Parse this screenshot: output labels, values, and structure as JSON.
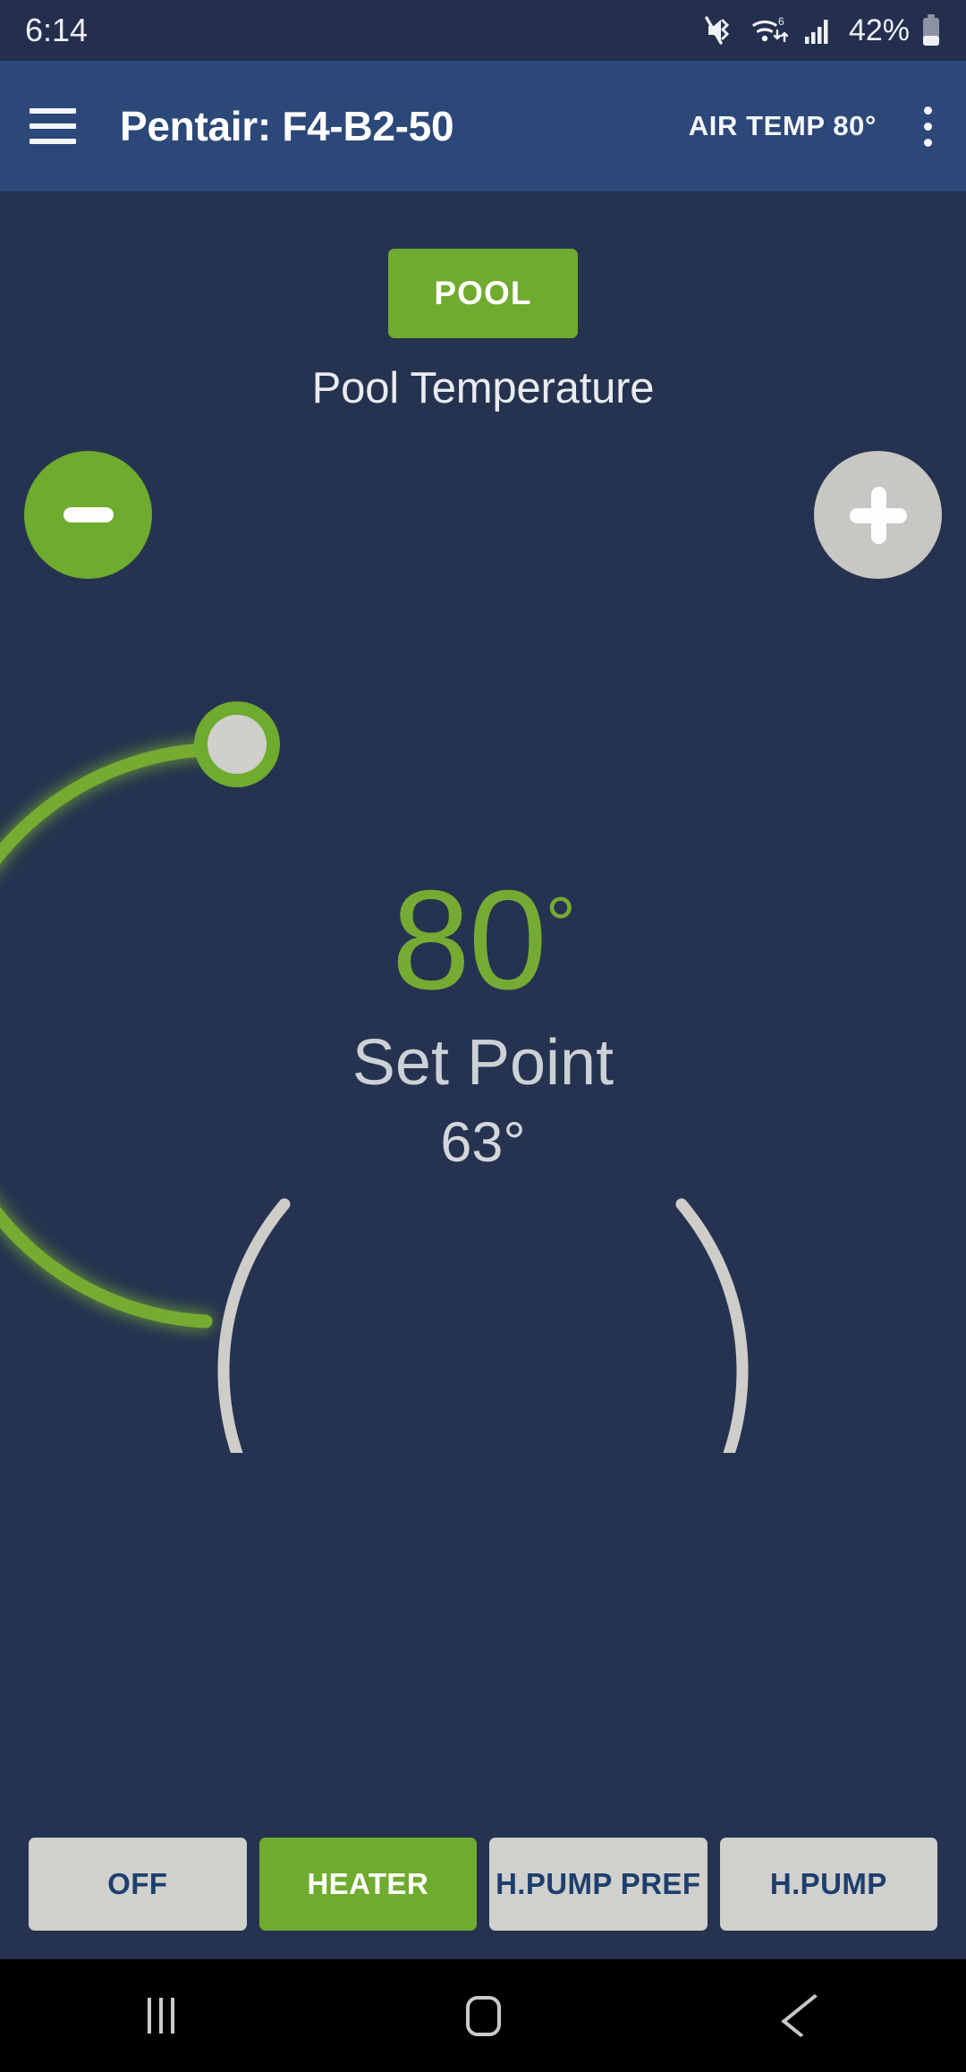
{
  "status_bar": {
    "clock": "6:14",
    "battery_percent": "42%",
    "icons": [
      "mute-vibrate-icon",
      "wifi-6-icon",
      "cellular-signal-icon",
      "battery-icon"
    ]
  },
  "app_bar": {
    "menu_icon": "hamburger-menu-icon",
    "title": "Pentair: F4-B2-50",
    "air_temp": "AIR TEMP 80°",
    "overflow_icon": "kebab-menu-icon"
  },
  "body_circuit": {
    "mode_chip_label": "POOL",
    "temperature_label": "Pool Temperature",
    "decrement_label": "−",
    "increment_label": "+"
  },
  "dial": {
    "current_temp": "80",
    "degree_symbol": "°",
    "setpoint_label": "Set Point",
    "setpoint_value": "63°",
    "progress_color": "#76ab33",
    "track_color": "#cfcdc9",
    "thumb_fill": "#cfcfcb",
    "thumb_ring": "#6fab2e"
  },
  "heat_modes": [
    {
      "label": "OFF",
      "active": false
    },
    {
      "label": "HEATER",
      "active": true
    },
    {
      "label": "H.PUMP PREF",
      "active": false
    },
    {
      "label": "H.PUMP",
      "active": false
    }
  ],
  "nav_bar": {
    "recents": "recents-icon",
    "home": "home-icon",
    "back": "back-icon"
  },
  "colors": {
    "status_bar_bg": "#232f4d",
    "app_bar_bg": "#2c4878",
    "page_bg": "#263350",
    "accent_green": "#6fab2e",
    "inactive_gray": "#d0d0cd",
    "dark_blue_text": "#1d3f6d"
  },
  "chart_data": {
    "type": "gauge",
    "title": "Pool Temperature",
    "current_value": 80,
    "setpoint": 63,
    "unit": "°F",
    "arc_sweep_degrees": 280,
    "arc_start_angle_deg": 140,
    "progress_fraction": 0.33,
    "progress_color": "#76ab33",
    "track_color": "#cfcdc9"
  }
}
